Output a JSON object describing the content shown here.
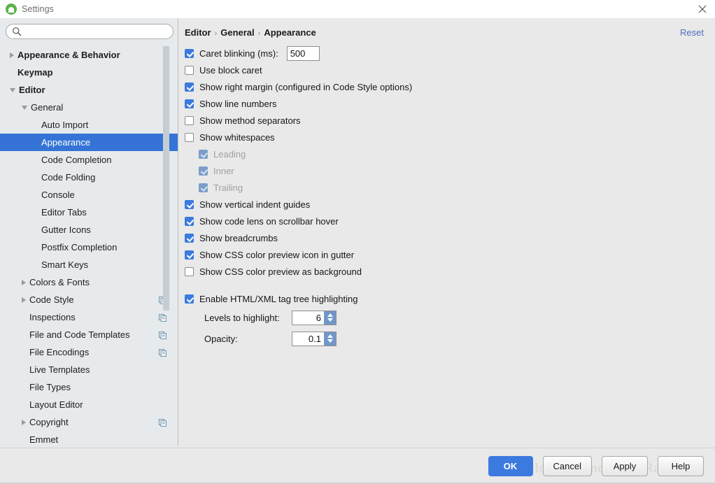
{
  "window": {
    "title": "Settings",
    "app_icon": "android-studio-icon",
    "close_icon": "close-icon"
  },
  "sidebar": {
    "search": {
      "value": "",
      "placeholder": "",
      "icon": "search-icon"
    },
    "items": [
      {
        "label": "Appearance & Behavior",
        "indent": 0,
        "arrow": "right",
        "bold": true,
        "selected": false,
        "copy": false
      },
      {
        "label": "Keymap",
        "indent": 0,
        "arrow": "none",
        "bold": true,
        "selected": false,
        "copy": false
      },
      {
        "label": "Editor",
        "indent": 0,
        "arrow": "down",
        "bold": true,
        "selected": false,
        "copy": false
      },
      {
        "label": "General",
        "indent": 1,
        "arrow": "down",
        "bold": false,
        "selected": false,
        "copy": false
      },
      {
        "label": "Auto Import",
        "indent": 2,
        "arrow": "none",
        "bold": false,
        "selected": false,
        "copy": false
      },
      {
        "label": "Appearance",
        "indent": 2,
        "arrow": "none",
        "bold": false,
        "selected": true,
        "copy": false
      },
      {
        "label": "Code Completion",
        "indent": 2,
        "arrow": "none",
        "bold": false,
        "selected": false,
        "copy": false
      },
      {
        "label": "Code Folding",
        "indent": 2,
        "arrow": "none",
        "bold": false,
        "selected": false,
        "copy": false
      },
      {
        "label": "Console",
        "indent": 2,
        "arrow": "none",
        "bold": false,
        "selected": false,
        "copy": false
      },
      {
        "label": "Editor Tabs",
        "indent": 2,
        "arrow": "none",
        "bold": false,
        "selected": false,
        "copy": false
      },
      {
        "label": "Gutter Icons",
        "indent": 2,
        "arrow": "none",
        "bold": false,
        "selected": false,
        "copy": false
      },
      {
        "label": "Postfix Completion",
        "indent": 2,
        "arrow": "none",
        "bold": false,
        "selected": false,
        "copy": false
      },
      {
        "label": "Smart Keys",
        "indent": 2,
        "arrow": "none",
        "bold": false,
        "selected": false,
        "copy": false
      },
      {
        "label": "Colors & Fonts",
        "indent": 1,
        "arrow": "right",
        "bold": false,
        "selected": false,
        "copy": false
      },
      {
        "label": "Code Style",
        "indent": 1,
        "arrow": "right",
        "bold": false,
        "selected": false,
        "copy": true
      },
      {
        "label": "Inspections",
        "indent": 1,
        "arrow": "none",
        "bold": false,
        "selected": false,
        "copy": true
      },
      {
        "label": "File and Code Templates",
        "indent": 1,
        "arrow": "none",
        "bold": false,
        "selected": false,
        "copy": true
      },
      {
        "label": "File Encodings",
        "indent": 1,
        "arrow": "none",
        "bold": false,
        "selected": false,
        "copy": true
      },
      {
        "label": "Live Templates",
        "indent": 1,
        "arrow": "none",
        "bold": false,
        "selected": false,
        "copy": false
      },
      {
        "label": "File Types",
        "indent": 1,
        "arrow": "none",
        "bold": false,
        "selected": false,
        "copy": false
      },
      {
        "label": "Layout Editor",
        "indent": 1,
        "arrow": "none",
        "bold": false,
        "selected": false,
        "copy": false
      },
      {
        "label": "Copyright",
        "indent": 1,
        "arrow": "right",
        "bold": false,
        "selected": false,
        "copy": true
      },
      {
        "label": "Emmet",
        "indent": 1,
        "arrow": "none",
        "bold": false,
        "selected": false,
        "copy": false
      }
    ]
  },
  "content": {
    "breadcrumb": [
      "Editor",
      "General",
      "Appearance"
    ],
    "breadcrumb_separator": "›",
    "reset_label": "Reset",
    "options": [
      {
        "label": "Caret blinking (ms):",
        "checked": true,
        "disabled": false,
        "indented": false,
        "field": "500"
      },
      {
        "label": "Use block caret",
        "checked": false,
        "disabled": false,
        "indented": false
      },
      {
        "label": "Show right margin (configured in Code Style options)",
        "checked": true,
        "disabled": false,
        "indented": false
      },
      {
        "label": "Show line numbers",
        "checked": true,
        "disabled": false,
        "indented": false
      },
      {
        "label": "Show method separators",
        "checked": false,
        "disabled": false,
        "indented": false
      },
      {
        "label": "Show whitespaces",
        "checked": false,
        "disabled": false,
        "indented": false
      },
      {
        "label": "Leading",
        "checked": true,
        "disabled": true,
        "indented": true
      },
      {
        "label": "Inner",
        "checked": true,
        "disabled": true,
        "indented": true
      },
      {
        "label": "Trailing",
        "checked": true,
        "disabled": true,
        "indented": true
      },
      {
        "label": "Show vertical indent guides",
        "checked": true,
        "disabled": false,
        "indented": false
      },
      {
        "label": "Show code lens on scrollbar hover",
        "checked": true,
        "disabled": false,
        "indented": false
      },
      {
        "label": "Show breadcrumbs",
        "checked": true,
        "disabled": false,
        "indented": false
      },
      {
        "label": "Show CSS color preview icon in gutter",
        "checked": true,
        "disabled": false,
        "indented": false
      },
      {
        "label": "Show CSS color preview as background",
        "checked": false,
        "disabled": false,
        "indented": false
      }
    ],
    "tag_tree": {
      "label": "Enable HTML/XML tag tree highlighting",
      "checked": true,
      "levels_label": "Levels to highlight:",
      "levels_value": "6",
      "opacity_label": "Opacity:",
      "opacity_value": "0.1"
    }
  },
  "footer": {
    "watermark": "http://blog.csdn.net/LynnRachel",
    "buttons": [
      {
        "label": "OK",
        "primary": true
      },
      {
        "label": "Cancel",
        "primary": false
      },
      {
        "label": "Apply",
        "primary": false
      },
      {
        "label": "Help",
        "primary": false
      }
    ]
  },
  "colors": {
    "accent": "#3574d6",
    "checkbox_on": "#3a7bdd",
    "link": "#4c6fbf",
    "panel_bg": "#e9e9e9",
    "sidebar_bg": "#e6eaec"
  }
}
